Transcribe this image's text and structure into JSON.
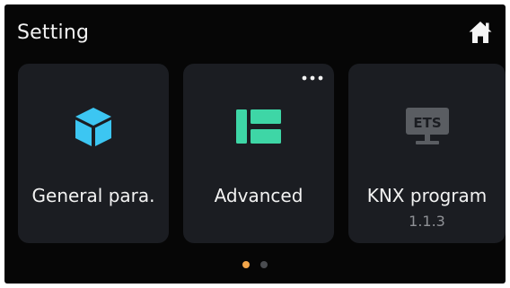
{
  "header": {
    "title": "Setting",
    "home_icon": "home-icon"
  },
  "cards": [
    {
      "label": "General para.",
      "icon": "cube-icon",
      "icon_color": "#3cc6f2"
    },
    {
      "label": "Advanced",
      "icon": "layout-icon",
      "icon_color": "#3ed6a6",
      "more_icon": "more-dots-icon"
    },
    {
      "label": "KNX program",
      "sub": "1.1.3",
      "icon": "ets-monitor-icon",
      "icon_text": "ETS",
      "icon_color": "#5a5d62"
    }
  ],
  "pager": {
    "pages": 2,
    "current": 1,
    "active_color": "#f2a54a",
    "inactive_color": "#4a4c50"
  }
}
